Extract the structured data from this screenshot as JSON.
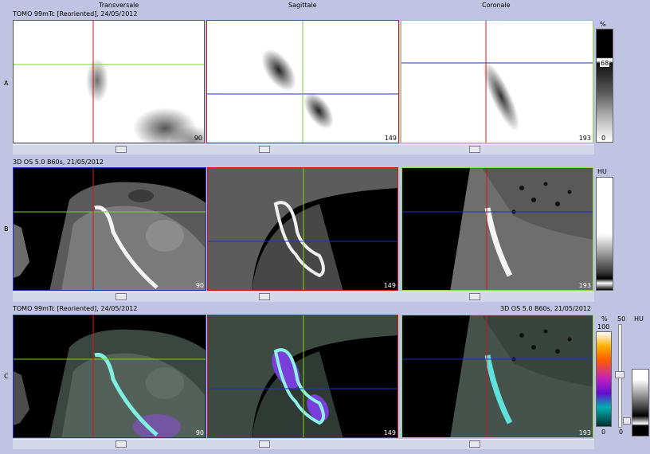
{
  "columns": {
    "transversal": "Transversale",
    "sagittal": "Sagittale",
    "coronal": "Coronale"
  },
  "rows": {
    "a": "A",
    "b": "B",
    "c": "C"
  },
  "series": {
    "tomo": "TOMO 99mTc [Reoriented], 24/05/2012",
    "ct": "3D OS 5.0 B60s, 21/05/2012"
  },
  "slices": {
    "transversal": "90",
    "sagittal": "149",
    "coronal": "193"
  },
  "scales": {
    "a_unit": "%",
    "a_value": "68",
    "a_min": "0",
    "b_unit": "HU",
    "c_pct_unit": "%",
    "c_max": "100",
    "c_min": "0",
    "c_level": "50",
    "c_level_min": "0",
    "c_hu_unit": "HU"
  },
  "colors": {
    "background": "#c0c4e2",
    "crosshair_red": "#d01818",
    "crosshair_green": "#7ed321",
    "crosshair_blue": "#2030c8",
    "frame_blue": "#2030c8",
    "frame_red": "#d01818",
    "frame_green": "#8fd84a"
  }
}
